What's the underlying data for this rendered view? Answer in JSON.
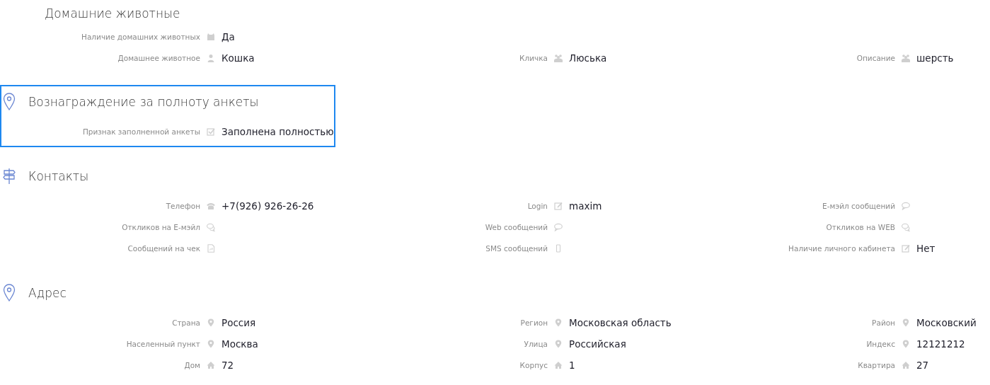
{
  "sections": [
    {
      "title": "Домашние животные",
      "kind": "plain",
      "selected": false,
      "rows": [
        [
          {
            "label": "Наличие домашних животных",
            "value": "Да"
          }
        ],
        [
          {
            "label": "Домашнее животное",
            "value": "Кошка"
          },
          {
            "label": "Кличка",
            "value": "Люська"
          },
          {
            "label": "Описание",
            "value": "шерсть"
          }
        ]
      ]
    },
    {
      "title": "Вознаграждение за полноту анкеты",
      "kind": "reward",
      "selected": true,
      "rows": [
        [
          {
            "label": "Признак заполненной анкеты",
            "value": "Заполнена полностью"
          }
        ]
      ]
    },
    {
      "title": "Контакты",
      "kind": "contacts",
      "selected": false,
      "rows": [
        [
          {
            "label": "Телефон",
            "value": "+7(926) 926-26-26"
          },
          {
            "label": "Login",
            "value": "maxim"
          },
          {
            "label": "E-мэйл сообщений"
          }
        ],
        [
          {
            "label": "Откликов на E-мэйл"
          },
          {
            "label": "Web сообщений"
          },
          {
            "label": "Откликов на WEB"
          }
        ],
        [
          {
            "label": "Сообщений на чек"
          },
          {
            "label": "SMS сообщений"
          },
          {
            "label": "Наличие личного кабинета",
            "value": "Нет"
          }
        ]
      ]
    },
    {
      "title": "Адрес",
      "kind": "address",
      "selected": false,
      "rows": [
        [
          {
            "label": "Страна",
            "value": "Россия"
          },
          {
            "label": "Регион",
            "value": "Московская область"
          },
          {
            "label": "Район",
            "value": "Московский"
          }
        ],
        [
          {
            "label": "Населенный пункт",
            "value": "Москва"
          },
          {
            "label": "Улица",
            "value": "Российская"
          },
          {
            "label": "Индекс",
            "value": "12121212"
          }
        ],
        [
          {
            "label": "Дом",
            "value": "72"
          },
          {
            "label": "Корпус",
            "value": "1"
          },
          {
            "label": "Квартира",
            "value": "27"
          }
        ]
      ]
    }
  ]
}
